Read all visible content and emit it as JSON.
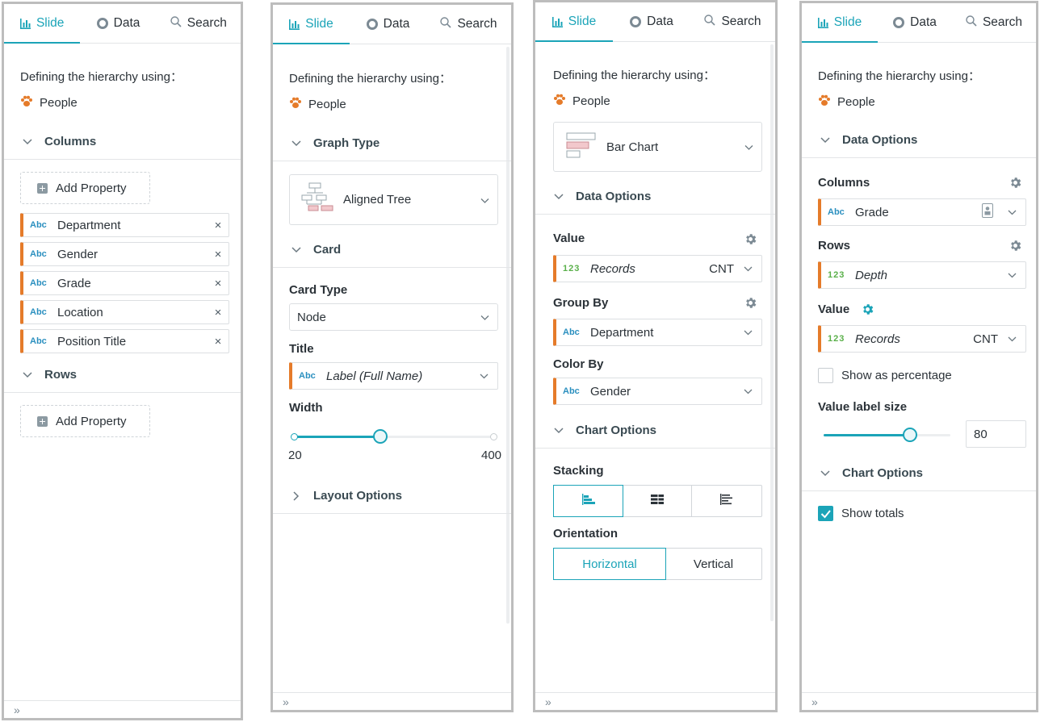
{
  "tabs": {
    "slide": "Slide",
    "data": "Data",
    "search": "Search"
  },
  "common": {
    "defining_label": "Defining the hierarchy using：",
    "entity": "People",
    "footer_glyph": "»"
  },
  "panel1": {
    "columns_section": "Columns",
    "add_property": "Add Property",
    "columns": [
      "Department",
      "Gender",
      "Grade",
      "Location",
      "Position Title"
    ],
    "abc": "Abc",
    "close": "×",
    "rows_section": "Rows",
    "add_property_rows": "Add Property"
  },
  "panel2": {
    "graph_type_section": "Graph Type",
    "graph_type_value": "Aligned Tree",
    "card_section": "Card",
    "card_type_label": "Card Type",
    "card_type_value": "Node",
    "title_label": "Title",
    "title_tag": "Abc",
    "title_value": "Label (Full Name)",
    "width_label": "Width",
    "width_min": "20",
    "width_max": "400",
    "width_fraction": 0.43,
    "layout_section": "Layout Options"
  },
  "panel3": {
    "chart_type_value": "Bar Chart",
    "data_options_section": "Data Options",
    "value_label": "Value",
    "value_tag": "123",
    "value_field": "Records",
    "value_agg": "CNT",
    "group_by_label": "Group By",
    "group_by_tag": "Abc",
    "group_by_field": "Department",
    "color_by_label": "Color By",
    "color_by_tag": "Abc",
    "color_by_field": "Gender",
    "chart_options_section": "Chart Options",
    "stacking_label": "Stacking",
    "orientation_label": "Orientation",
    "orientation_horizontal": "Horizontal",
    "orientation_vertical": "Vertical"
  },
  "panel4": {
    "data_options_section": "Data Options",
    "columns_label": "Columns",
    "columns_tag": "Abc",
    "columns_field": "Grade",
    "rows_label": "Rows",
    "rows_tag": "123",
    "rows_field": "Depth",
    "value_label": "Value",
    "value_tag": "123",
    "value_field": "Records",
    "value_agg": "CNT",
    "show_percentage": "Show as percentage",
    "value_label_size": "Value label size",
    "value_label_size_input": "80",
    "value_label_size_fraction": 0.68,
    "chart_options_section": "Chart Options",
    "show_totals": "Show totals"
  },
  "colors": {
    "accent": "#1ba4b8",
    "pill_border": "#e57b2a",
    "people_icon": "#e57b2a"
  }
}
